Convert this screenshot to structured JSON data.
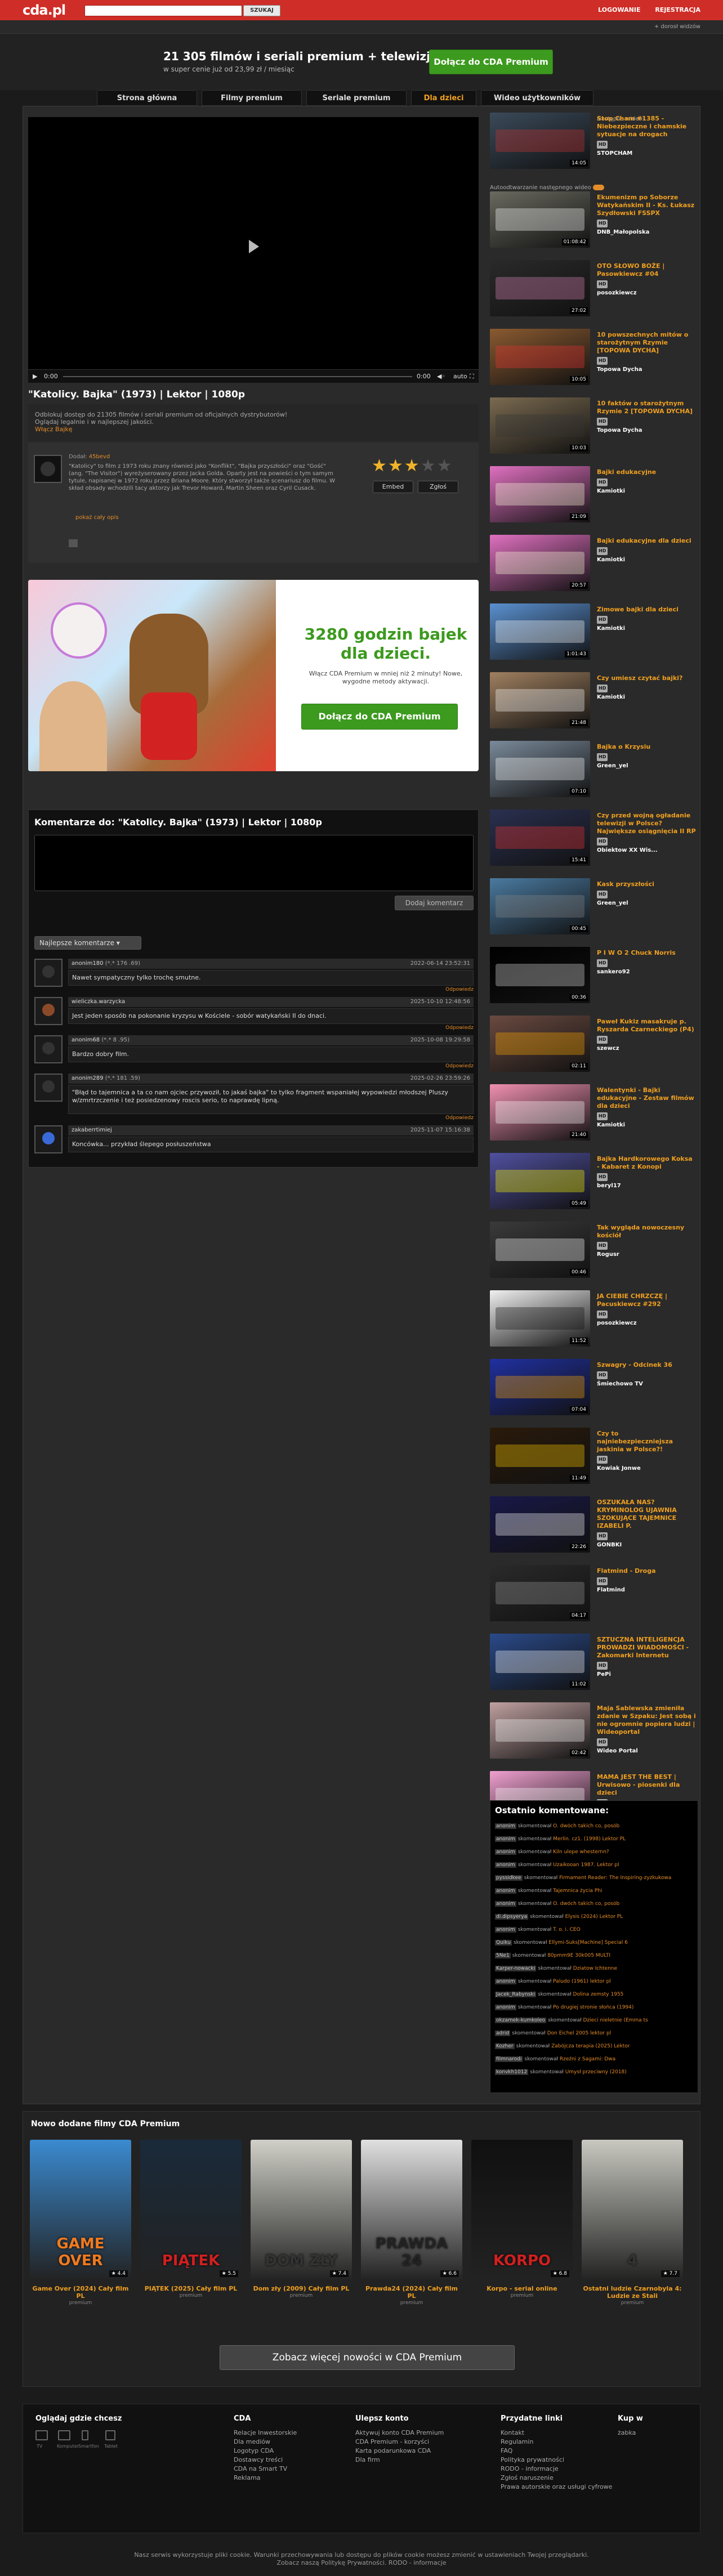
{
  "header": {
    "logo": "cda.pl",
    "search_button": "SZUKAJ",
    "login": "LOGOWANIE",
    "register": "REJESTRACJA",
    "age_notice": "+ dorosł widzów"
  },
  "promo": {
    "title": "21 305 filmów i seriali premium + telewizja",
    "subtitle": "w super cenie już od 23,99 zł / miesiąc",
    "cta": "Dołącz do CDA Premium"
  },
  "tabs": [
    "Strona główna",
    "Filmy premium",
    "Seriale premium",
    "Dla dzieci",
    "Wideo użytkowników"
  ],
  "player": {
    "time_current": "0:00",
    "time_total": "0:00",
    "quality": "auto"
  },
  "video": {
    "title": "\"Katolicy. Bajka\" (1973) | Lektor | 1080p",
    "desc_line1": "Odblokuj dostęp do 21305 filmów i seriali premium od oficjalnych dystrybutorów!",
    "desc_line2": "Oglądaj legalnie i w najlepszej jakości.",
    "desc_link": "Włącz Bajkę"
  },
  "info": {
    "added": "Dodał:",
    "uploader": "45bevd",
    "text": "\"Katolicy\" to film z 1973 roku znany również jako \"Konflikt\", \"Bajka przyszłości\" oraz \"Gość\" (ang. \"The Visitor\") wyreżyserowany przez Jacka Golda. Oparty jest na powieści o tym samym tytule, napisanej w 1972 roku przez Briana Moore. Który stworzył także scenariusz do filmu. W skład obsady wchodzili tacy aktorzy jak Trevor Howard, Martin Sheen oraz Cyril Cusack.",
    "show_all": "pokaż cały opis",
    "embed": "Embed",
    "report": "Zgłoś",
    "rating": 3
  },
  "ad": {
    "title": "3280 godzin bajek dla dzieci.",
    "sub": "Włącz CDA Premium w mniej niż 2 minuty! Nowe, wygodne metody aktywacji.",
    "cta": "Dołącz do CDA Premium"
  },
  "comments": {
    "title": "Komentarze do: \"Katolicy. Bajka\" (1973) | Lektor | 1080p",
    "submit": "Dodaj komentarz",
    "sort": "Najlepsze komentarze",
    "reply": "Odpowiedz",
    "items": [
      {
        "user": "anonim180",
        "meta": "(*.* 176 .69)",
        "when": "2022-06-14 23:52:31",
        "text": "Nawet sympatyczny tylko trochę smutne."
      },
      {
        "user": "wieliczka.warzycka",
        "meta": "",
        "when": "2025-10-10 12:48:56",
        "text": "Jest jeden sposób na pokonanie kryzysu w Kościele - sobór watykański II do dnaci."
      },
      {
        "user": "anonim68",
        "meta": "(*.* 8 .95)",
        "when": "2025-10-08 19:29:58",
        "text": "Bardzo dobry film."
      },
      {
        "user": "anonim289",
        "meta": "(*.* 181 .59)",
        "when": "2025-02-26 23:59:26",
        "text": "\"Błąd to tajemnica a ta co nam ojciec przywoził, to jakaś bajka\" to tylko fragment wspaniałej wypowiedzi młodszej Pluszy w/zmrtrzczenie i też posiedzenowy roscis serio, to naprawdę lipną."
      },
      {
        "user": "zakaberrtimiej",
        "meta": "",
        "when": "2025-11-07 15:16:38",
        "text": "Koncówka... przykład ślepego posłuszeństwa"
      }
    ]
  },
  "sidebar": {
    "next_label": "Następne wideo:",
    "autoplay": "Autoodtwarzanie następnego wideo",
    "badge": "HD",
    "items": [
      {
        "title": "Stop Cham #1385 - Niebezpieczne i chamskie sytuacje na drogach",
        "author": "STOPCHAM",
        "dur": "14:05"
      },
      {
        "title": "Ekumenizm po Soborze Watykańskim II - Ks. Łukasz Szydłowski FSSPX",
        "author": "DNB_Małopolska",
        "dur": "01:08:42"
      },
      {
        "title": "OTO SŁOWO BOŻE | Pasowkiewcz #04",
        "author": "posozkiewcz",
        "dur": "27:02"
      },
      {
        "title": "10 powszechnych mitów o starożytnym Rzymie [TOPOWA DYCHA]",
        "author": "Topowa Dycha",
        "dur": "10:05"
      },
      {
        "title": "10 faktów o starożytnym Rzymie 2 [TOPOWA DYCHA]",
        "author": "Topowa Dycha",
        "dur": "10:03"
      },
      {
        "title": "Bajki edukacyjne",
        "author": "Kamiotki",
        "dur": "21:09"
      },
      {
        "title": "Bajki edukacyjne dla dzieci",
        "author": "Kamiotki",
        "dur": "20:57"
      },
      {
        "title": "Zimowe bajki dla dzieci",
        "author": "Kamiotki",
        "dur": "1:01:43"
      },
      {
        "title": "Czy umiesz czytać bajki?",
        "author": "Kamiotki",
        "dur": "21:48"
      },
      {
        "title": "Bajka o Krzysiu",
        "author": "Green_yel",
        "dur": "07:10"
      },
      {
        "title": "Czy przed wojną ogładanie telewizji w Polsce? Największe osiągnięcia II RP",
        "author": "Obiektow XX Wis...",
        "dur": "15:41"
      },
      {
        "title": "Kask przyszłości",
        "author": "Green_yel",
        "dur": "00:45"
      },
      {
        "title": "P I W O 2 Chuck Norris",
        "author": "sankero92",
        "dur": "00:36"
      },
      {
        "title": "Paweł Kukiz masakruje p. Ryszarda Czarneckiego (P4)",
        "author": "szewcz",
        "dur": "02:11"
      },
      {
        "title": "Walentynki - Bajki edukacyjne - Zestaw filmów dla dzieci",
        "author": "Kamiotki",
        "dur": "21:40"
      },
      {
        "title": "Bajka Hardkorowego Koksa - Kabaret z Konopi",
        "author": "beryl17",
        "dur": "05:49"
      },
      {
        "title": "Tak wygląda nowoczesny kościół",
        "author": "Rogusr",
        "dur": "00:46"
      },
      {
        "title": "JA CIEBIE CHRZCZĘ | Pacuskiewcz #292",
        "author": "posozkiewcz",
        "dur": "11:52"
      },
      {
        "title": "Szwagry - Odcinek 36",
        "author": "Śmiechowo TV",
        "dur": "07:04"
      },
      {
        "title": "Czy to najniebezpieczniejsza jaskinia w Polsce?!",
        "author": "Kowiak Jonwe",
        "dur": "11:49"
      },
      {
        "title": "OSZUKAŁA NAS? KRYMINOLOG UJAWNIA SZOKUJĄCE TAJEMNICE IZABELI P.",
        "author": "GONBKI",
        "dur": "22:26"
      },
      {
        "title": "Flatmind - Droga",
        "author": "Flatmind",
        "dur": "04:17"
      },
      {
        "title": "SZTUCZNA INTELIGENCJA PROWADZI WIADOMOŚCI - Zakomarki Internetu",
        "author": "PePi",
        "dur": "11:02"
      },
      {
        "title": "Maja Sablewska zmieniła zdanie w Szpaku: Jest sobą i nie ogromnie popiera ludzi | Wideoportal",
        "author": "Wideo Portal",
        "dur": "02:42"
      },
      {
        "title": "MAMA JEST THE BEST | Urwisowo - piosenki dla dzieci",
        "author": "Urwisowo",
        "dur": "02:21"
      }
    ]
  },
  "last_comments": {
    "title": "Ostatnio komentowane:",
    "lines": [
      [
        "anonim",
        "skomentował",
        "O. dwóch takich co, posób"
      ],
      [
        "anonim",
        "skomentował",
        "Merlin. cz1. (1998) Lektor PL"
      ],
      [
        "anonim",
        "skomentował",
        "Kiln ulepe whesternn?"
      ],
      [
        "anonim",
        "skomentował",
        "Uzaikooan 1987. Lektor pl"
      ],
      [
        "pyssidkee",
        "skomentował",
        "Firmament Reader: The Inspiring-zyzkukowa"
      ],
      [
        "anonim",
        "skomentował",
        "Tajemnica życia Phi"
      ],
      [
        "anonim",
        "skomentował",
        "O. dwóch takich co, posób"
      ],
      [
        "di.dipsyerya",
        "skomentował",
        "Elysis (2024) Lektor PL"
      ],
      [
        "anonim",
        "skomentował",
        "T. o. i. CEO"
      ],
      [
        "Quiku",
        "skomentował",
        "Ellymi-Suks[Machine] Special 6"
      ],
      [
        "5Ne1",
        "skomentował",
        "80pmm9E 30k005 MULTI"
      ],
      [
        "Karper-nowacki",
        "skomentował",
        "Dziatow Ichtenne"
      ],
      [
        "anonim",
        "skomentował",
        "Paludo (1961) lektor pl"
      ],
      [
        "Jacek_Rabynski",
        "skomentował",
        "Dolina zemsty 1955"
      ],
      [
        "anonim",
        "skomentował",
        "Po drugiej stronie słońca (1994)"
      ],
      [
        "okzamek-kumkoleo",
        "skomentował",
        "Dzieci nieletnie (Emma ts"
      ],
      [
        "adrid",
        "skomentował",
        "Don Eichel 2005 lektor pl"
      ],
      [
        "Kozher",
        "skomentował",
        "Zabójcza terapia (2025) Lektor"
      ],
      [
        "filmnarodi",
        "skomentował",
        "Rzeźni z Sagami: Dwa"
      ],
      [
        "konvkh1012",
        "skomentował",
        "Umysł przeciwny (2018)"
      ]
    ]
  },
  "new_films": {
    "title": "Nowo dodane filmy CDA Premium",
    "more": "Zobacz więcej nowości w CDA Premium",
    "items": [
      {
        "title": "Game Over (2024) Cały film PL",
        "sub": "premium",
        "poster_text": "GAME OVER",
        "rating": "4.4"
      },
      {
        "title": "PIĄTEK (2025) Cały film PL",
        "sub": "premium",
        "poster_text": "PIĄTEK",
        "rating": "5.5"
      },
      {
        "title": "Dom zły (2009) Cały film PL",
        "sub": "premium",
        "poster_text": "DOM ZŁY",
        "rating": "7.4"
      },
      {
        "title": "Prawda24 (2024) Cały film PL",
        "sub": "premium",
        "poster_text": "PRAWDA 24",
        "rating": "6.6"
      },
      {
        "title": "Korpo - serial online",
        "sub": "premium",
        "poster_text": "KORPO",
        "rating": "6.8"
      },
      {
        "title": "Ostatni ludzie Czarnobyla 4: Ludzie ze Stali",
        "sub": "premium",
        "poster_text": "4",
        "rating": "7.7"
      }
    ]
  },
  "footer": {
    "cols": [
      {
        "h": "Oglądaj gdzie chcesz",
        "l": []
      },
      {
        "h": "CDA",
        "l": [
          "Relacje Inwestorskie",
          "Dla mediów",
          "Logotyp CDA",
          "Dostawcy treści",
          "CDA na Smart TV",
          "Reklama"
        ]
      },
      {
        "h": "Ulepsz konto",
        "l": [
          "Aktywuj konto CDA Premium",
          "CDA Premium - korzyści",
          "Karta podarunkowa CDA",
          "Dla firm"
        ]
      },
      {
        "h": "Przydatne linki",
        "l": [
          "Kontakt",
          "Regulamin",
          "FAQ",
          "Polityka prywatności",
          "RODO - informacje",
          "Zgłoś naruszenie",
          "Prawa autorskie oraz usługi cyfrowe"
        ]
      },
      {
        "h": "Kup w",
        "l": [
          "żabka"
        ]
      }
    ],
    "devices": [
      "TV",
      "Komputer",
      "Smartfon",
      "Tablet"
    ],
    "note1": "Nasz serwis wykorzystuje pliki cookie. Warunki przechowywania lub dostępu do plików cookie możesz zmienić w ustawieniach Twojej przeglądarki.",
    "note2": "Zobacz naszą Politykę Prywatności. RODO - informacje"
  },
  "colors": {
    "accent": "#cf2d27",
    "premium_green": "#3c9a1e",
    "link_orange": "#e48c2a",
    "star": "#f0b429"
  }
}
